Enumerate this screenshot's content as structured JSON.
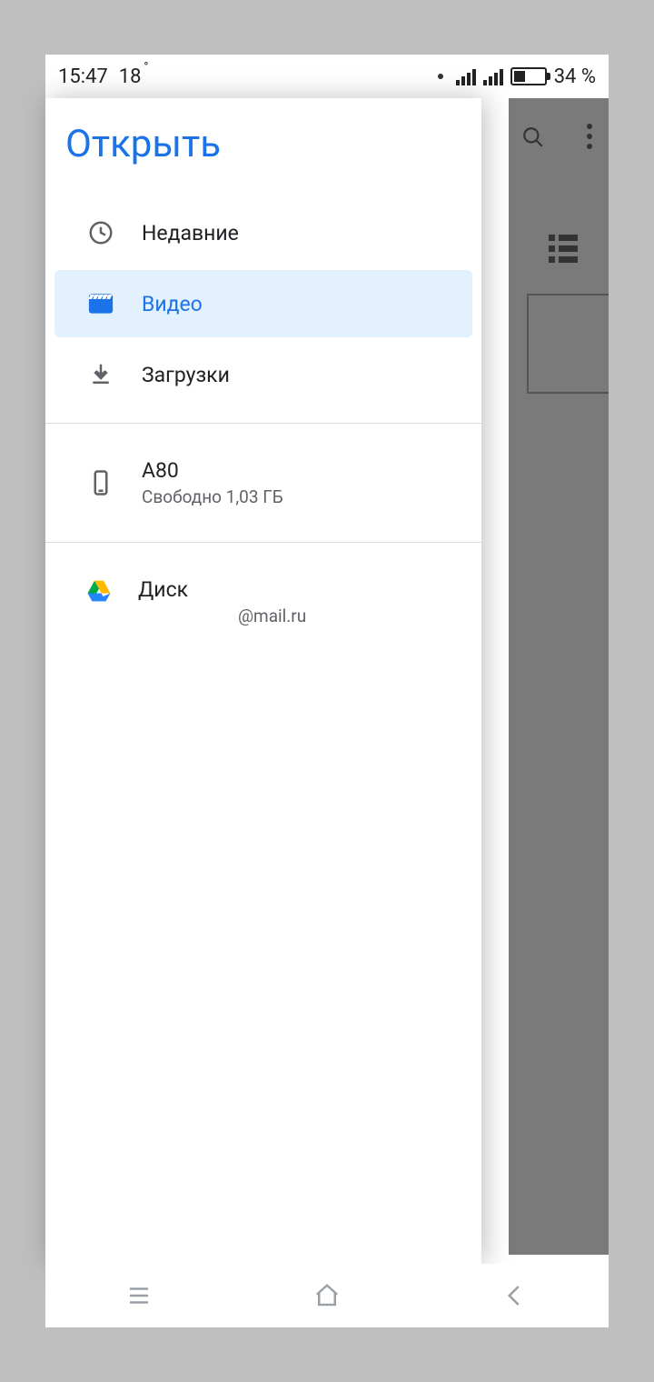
{
  "statusbar": {
    "time": "15:47",
    "temp": "18",
    "battery_pct": "34 %"
  },
  "drawer": {
    "title": "Открыть",
    "items": [
      {
        "kind": "nav",
        "icon": "clock-icon",
        "label": "Недавние"
      },
      {
        "kind": "nav",
        "icon": "video-icon",
        "label": "Видео",
        "selected": true
      },
      {
        "kind": "nav",
        "icon": "download-icon",
        "label": "Загрузки"
      },
      {
        "kind": "divider"
      },
      {
        "kind": "storage",
        "icon": "phone-icon",
        "label": "A80",
        "sub": "Свободно 1,03 ГБ"
      },
      {
        "kind": "divider"
      },
      {
        "kind": "account",
        "icon": "drive-icon",
        "label": "Диск",
        "sub_right": "@mail.ru"
      }
    ]
  },
  "colors": {
    "accent": "#1a73e8",
    "selected_bg": "#e3f0fe",
    "text": "#202124",
    "muted": "#5f6368"
  }
}
